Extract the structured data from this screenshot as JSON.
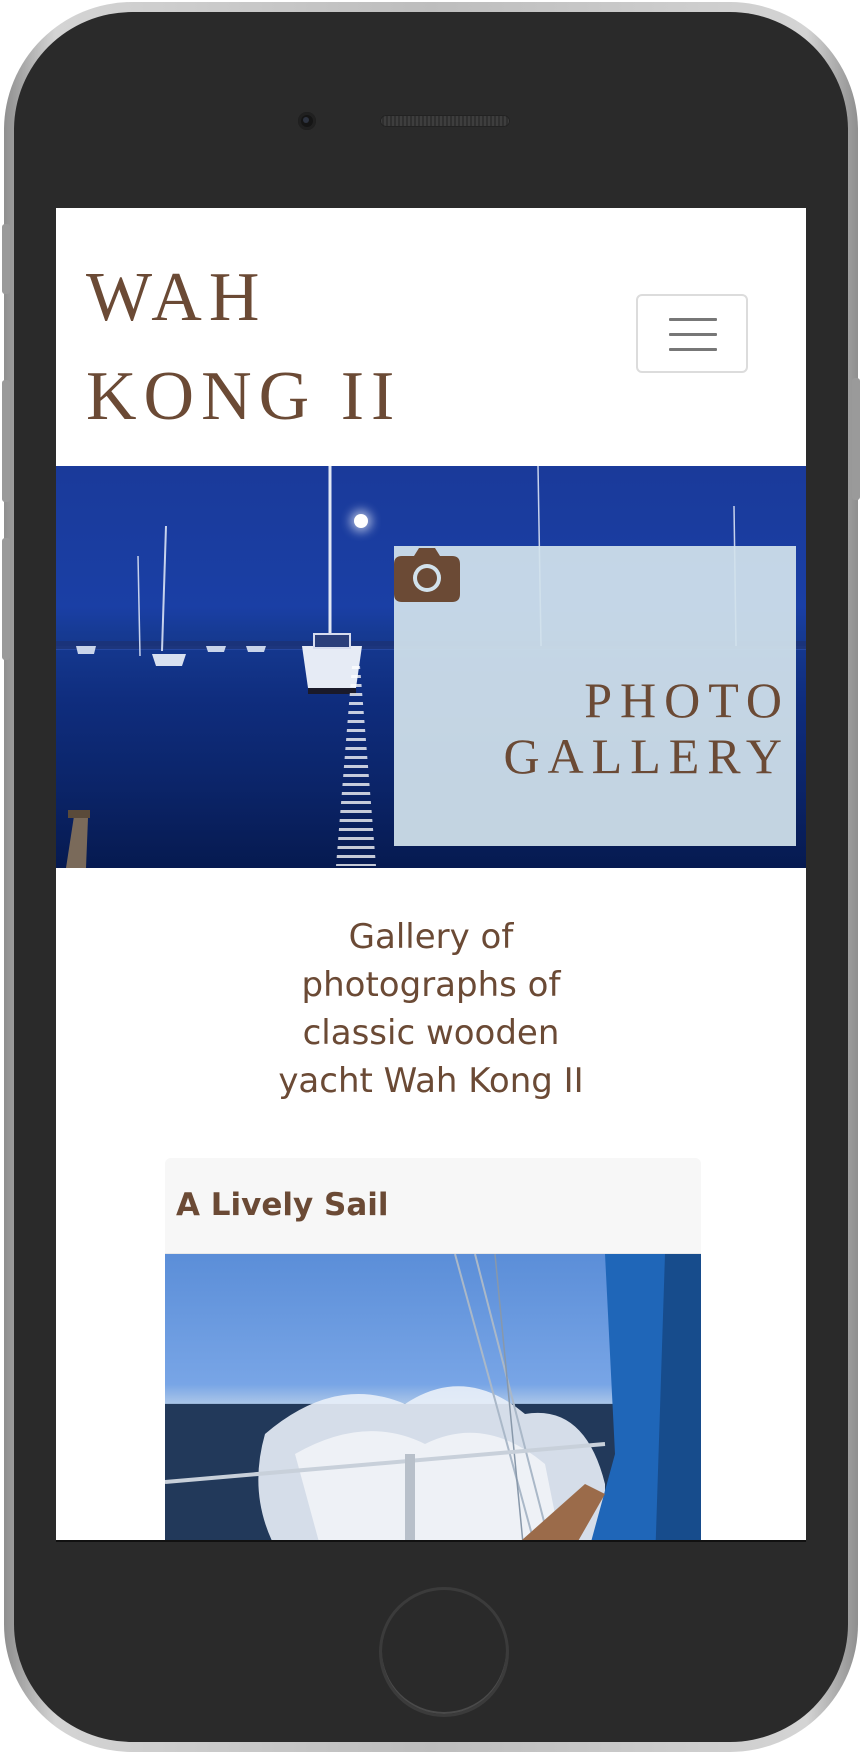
{
  "site": {
    "title_line1": "WAH",
    "title_line2": "KONG II"
  },
  "nav": {
    "menu_toggle_icon": "hamburger-menu-icon"
  },
  "hero": {
    "icon": "camera-icon",
    "heading_line1": "PHOTO",
    "heading_line2": "GALLERY"
  },
  "intro": {
    "text": "Gallery of photographs of classic wooden yacht Wah Kong II"
  },
  "gallery": {
    "items": [
      {
        "title": "A Lively Sail"
      }
    ]
  },
  "colors": {
    "brand_brown": "#6b4a35",
    "hero_overlay": "#d2e2ec",
    "card_header_bg": "#f7f7f7"
  }
}
